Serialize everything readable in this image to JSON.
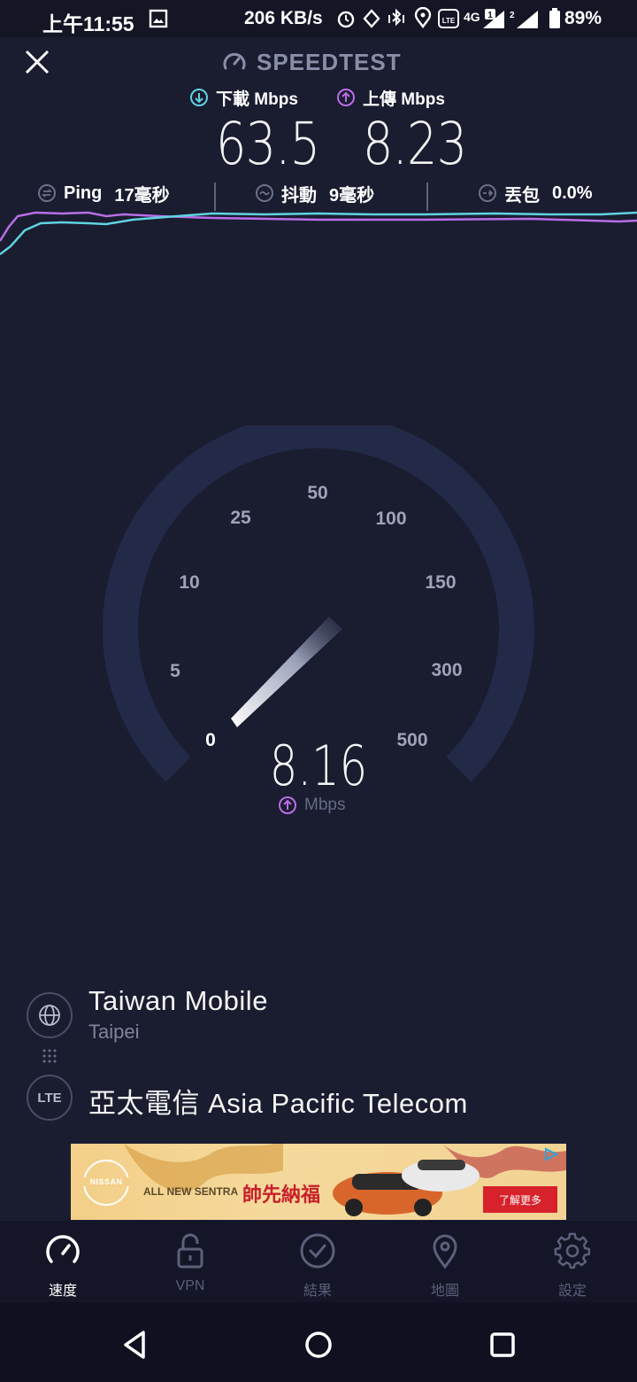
{
  "status_bar": {
    "time": "上午11:55",
    "network_speed": "206 KB/s",
    "battery": "89%"
  },
  "header": {
    "brand": "SPEEDTEST",
    "download_label": "下載 Mbps",
    "download_value": "63.5",
    "upload_label": "上傳 Mbps",
    "upload_value": "8.23"
  },
  "stats": {
    "ping_label": "Ping",
    "ping_value": "17毫秒",
    "jitter_label": "抖動",
    "jitter_value": "9毫秒",
    "loss_label": "丟包",
    "loss_value": "0.0%"
  },
  "gauge": {
    "ticks": [
      "0",
      "5",
      "10",
      "25",
      "50",
      "100",
      "150",
      "300",
      "500"
    ],
    "current_value": "8.16",
    "unit": "Mbps"
  },
  "server": {
    "name": "Taiwan Mobile",
    "location": "Taipei",
    "connection_type": "LTE",
    "provider": "亞太電信 Asia Pacific Telecom"
  },
  "ad": {
    "brand": "NISSAN",
    "tagline": "ALL NEW SENTRA",
    "slogan": "帥先納福",
    "cta": "了解更多"
  },
  "nav": [
    {
      "label": "速度",
      "icon": "speedometer-icon",
      "active": true
    },
    {
      "label": "VPN",
      "icon": "lock-icon",
      "active": false
    },
    {
      "label": "結果",
      "icon": "check-circle-icon",
      "active": false
    },
    {
      "label": "地圖",
      "icon": "map-pin-icon",
      "active": false
    },
    {
      "label": "設定",
      "icon": "gear-icon",
      "active": false
    }
  ],
  "colors": {
    "background": "#1a1c30",
    "download_accent": "#5fd3e0",
    "upload_accent": "#b86ee6",
    "gauge_track": "#232a48"
  }
}
